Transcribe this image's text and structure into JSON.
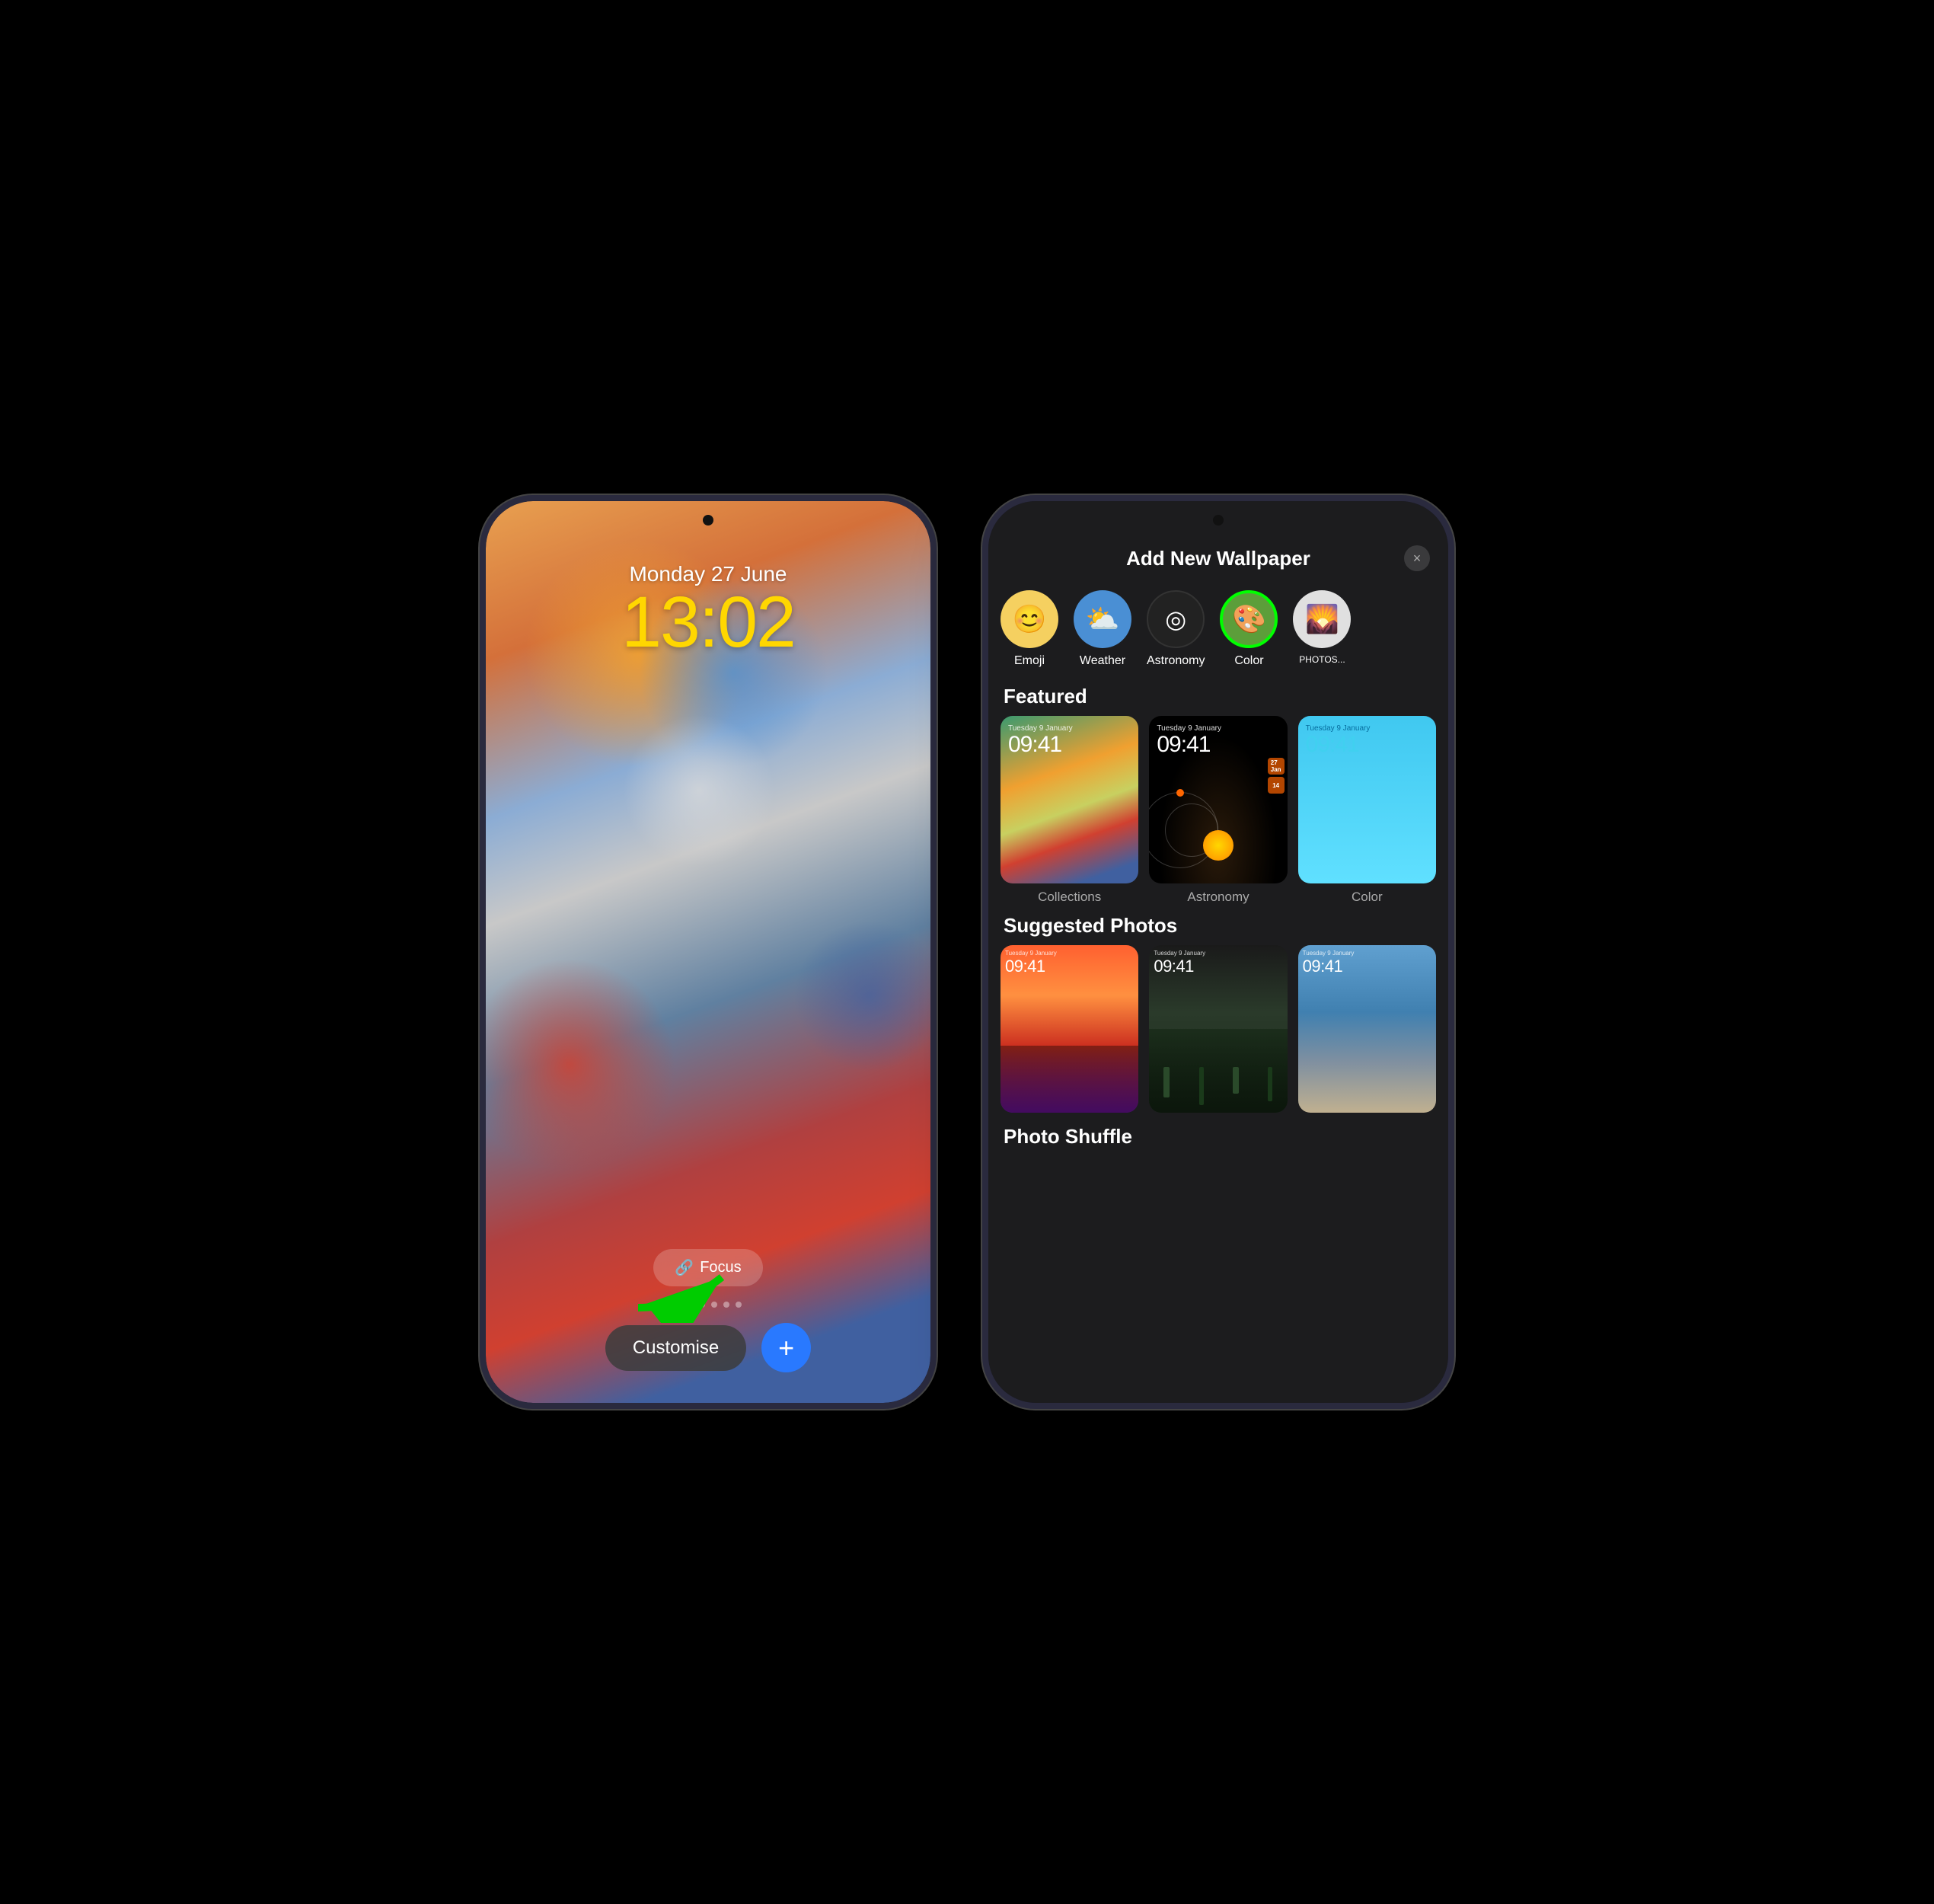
{
  "leftPhone": {
    "date": "Monday 27 June",
    "time": "13:02",
    "focusLabel": "Focus",
    "customiseLabel": "Customise",
    "plusLabel": "+"
  },
  "rightPhone": {
    "panelTitle": "Add New Wallpaper",
    "closeLabel": "×",
    "categories": [
      {
        "id": "emoji",
        "label": "Emoji",
        "icon": "😊",
        "colorClass": "cat-emoji"
      },
      {
        "id": "weather",
        "label": "Weather",
        "icon": "⛅",
        "colorClass": "cat-weather"
      },
      {
        "id": "astronomy",
        "label": "Astronomy",
        "icon": "🔭",
        "colorClass": "cat-astronomy"
      },
      {
        "id": "color",
        "label": "Color",
        "icon": "🎨",
        "colorClass": "cat-color"
      },
      {
        "id": "photos",
        "label": "PHOTOS_PER_DESC",
        "icon": "🌄",
        "colorClass": "cat-photos"
      }
    ],
    "featuredHeader": "Featured",
    "featured": [
      {
        "label": "Collections",
        "date": "Tuesday 9 January",
        "time": "09:41",
        "type": "collections"
      },
      {
        "label": "Astronomy",
        "date": "Tuesday 9 January",
        "time": "09:41",
        "type": "astronomy"
      },
      {
        "label": "Color",
        "date": "Tuesday 9 January",
        "time": "09:41",
        "type": "color"
      }
    ],
    "suggestedHeader": "Suggested Photos",
    "suggested": [
      {
        "date": "Tuesday 9 January",
        "time": "09:41",
        "type": "sunset"
      },
      {
        "date": "Tuesday 9 January",
        "time": "09:41",
        "type": "forest"
      },
      {
        "date": "Tuesday 9 January",
        "time": "09:41",
        "type": "coast"
      }
    ],
    "photoShuffleHeader": "Photo Shuffle"
  }
}
